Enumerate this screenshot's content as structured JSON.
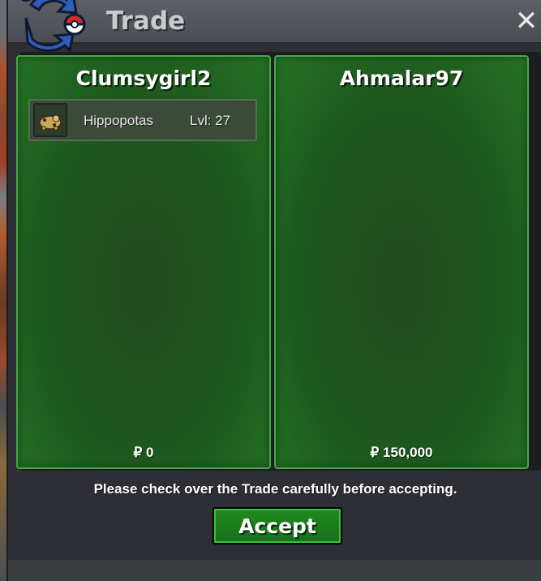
{
  "window": {
    "title": "Trade",
    "close_label": "✕"
  },
  "left_panel": {
    "trainer": "Clumsygirl2",
    "items": [
      {
        "icon": "hippopotas-sprite-icon",
        "name": "Hippopotas",
        "level": "Lvl: 27"
      }
    ],
    "money": "₽ 0"
  },
  "right_panel": {
    "trainer": "Ahmalar97",
    "items": [],
    "money": "₽ 150,000"
  },
  "notice": "Please check over the Trade carefully before accepting.",
  "accept_label": "Accept",
  "colors": {
    "panel_green": "#1e5a1e",
    "panel_border": "#45a845",
    "button_green": "#1f8a1f"
  }
}
